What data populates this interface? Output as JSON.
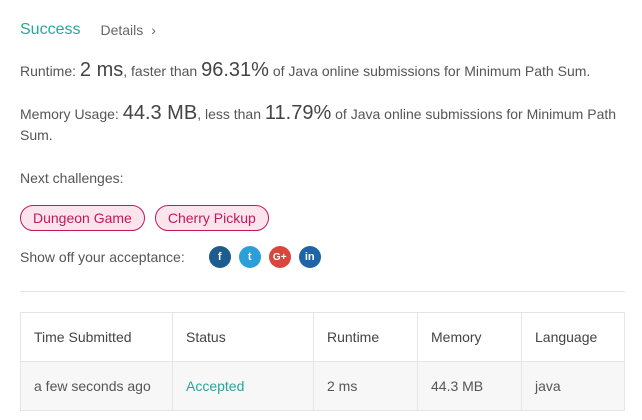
{
  "header": {
    "status": "Success",
    "details_label": "Details",
    "details_icon": "chevron-right-icon"
  },
  "runtime": {
    "label": "Runtime: ",
    "value": "2 ms",
    "middle": ", faster than ",
    "percent": "96.31%",
    "suffix": " of Java online submissions for Minimum Path Sum."
  },
  "memory": {
    "label": "Memory Usage: ",
    "value": "44.3 MB",
    "middle": ", less than ",
    "percent": "11.79%",
    "suffix": " of Java online submissions for Minimum Path Sum."
  },
  "next": {
    "label": "Next challenges:",
    "items": [
      "Dungeon Game",
      "Cherry Pickup"
    ]
  },
  "share": {
    "label": "Show off your acceptance:",
    "icons": [
      {
        "name": "facebook-icon",
        "glyph": "f"
      },
      {
        "name": "twitter-icon",
        "glyph": "t"
      },
      {
        "name": "google-plus-icon",
        "glyph": "G+"
      },
      {
        "name": "linkedin-icon",
        "glyph": "in"
      }
    ]
  },
  "table": {
    "headers": [
      "Time Submitted",
      "Status",
      "Runtime",
      "Memory",
      "Language"
    ],
    "rows": [
      [
        "a few seconds ago",
        "Accepted",
        "2 ms",
        "44.3 MB",
        "java"
      ]
    ]
  },
  "colors": {
    "success": "#26a69a",
    "tag": "#c2185b",
    "tag_bg": "#fce4ec"
  }
}
